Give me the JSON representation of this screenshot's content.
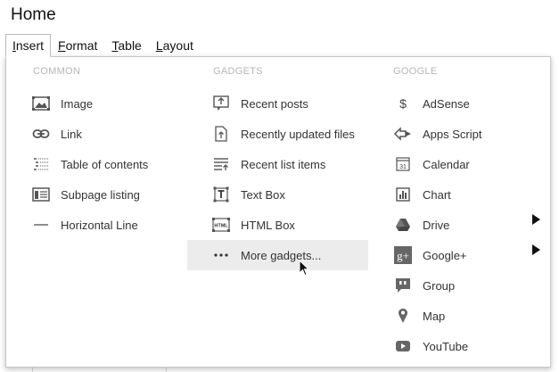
{
  "page": {
    "title": "Home"
  },
  "menubar": {
    "items": [
      {
        "label": "Insert",
        "mnemonic": "I",
        "rest": "nsert",
        "active": true
      },
      {
        "label": "Format",
        "mnemonic": "F",
        "rest": "ormat"
      },
      {
        "label": "Table",
        "mnemonic": "T",
        "rest": "able"
      },
      {
        "label": "Layout",
        "mnemonic": "L",
        "rest": "ayout"
      }
    ]
  },
  "insert_menu": {
    "columns": [
      {
        "header": "COMMON",
        "items": [
          {
            "label": "Image",
            "icon": "image-icon"
          },
          {
            "label": "Link",
            "icon": "link-icon"
          },
          {
            "label": "Table of contents",
            "icon": "table-of-contents-icon"
          },
          {
            "label": "Subpage listing",
            "icon": "subpage-listing-icon"
          },
          {
            "label": "Horizontal Line",
            "icon": "horizontal-line-icon"
          }
        ]
      },
      {
        "header": "GADGETS",
        "items": [
          {
            "label": "Recent posts",
            "icon": "recent-posts-icon"
          },
          {
            "label": "Recently updated files",
            "icon": "recently-updated-files-icon"
          },
          {
            "label": "Recent list items",
            "icon": "recent-list-items-icon"
          },
          {
            "label": "Text Box",
            "icon": "text-box-icon"
          },
          {
            "label": "HTML Box",
            "icon": "html-box-icon",
            "icon_text": "HTML"
          },
          {
            "label": "More gadgets...",
            "icon": "more-gadgets-icon",
            "highlighted": true
          }
        ]
      },
      {
        "header": "GOOGLE",
        "items": [
          {
            "label": "AdSense",
            "icon": "adsense-icon",
            "icon_text": "$"
          },
          {
            "label": "Apps Script",
            "icon": "apps-script-icon"
          },
          {
            "label": "Calendar",
            "icon": "calendar-icon",
            "icon_text": "31"
          },
          {
            "label": "Chart",
            "icon": "chart-icon"
          },
          {
            "label": "Drive",
            "icon": "drive-icon",
            "has_submenu": true
          },
          {
            "label": "Google+",
            "icon": "google-plus-icon",
            "icon_text": "g+",
            "has_submenu": true
          },
          {
            "label": "Group",
            "icon": "group-icon"
          },
          {
            "label": "Map",
            "icon": "map-icon"
          },
          {
            "label": "YouTube",
            "icon": "youtube-icon"
          }
        ]
      }
    ]
  }
}
